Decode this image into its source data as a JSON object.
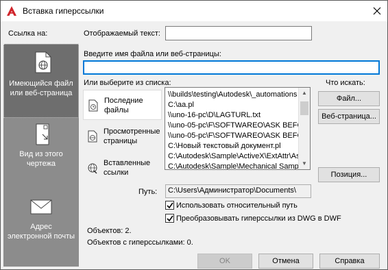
{
  "window": {
    "title": "Вставка гиперссылки"
  },
  "icons": {
    "app": "autocad-icon",
    "close": "close-icon"
  },
  "sidebar": {
    "header": "Ссылка на:",
    "items": [
      {
        "label_line1": "Имеющийся файл",
        "label_line2": "или веб-страница",
        "icon": "file-globe-icon",
        "selected": true
      },
      {
        "label_line1": "Вид из этого",
        "label_line2": "чертежа",
        "icon": "drawing-view-icon",
        "selected": false
      },
      {
        "label_line1": "Адрес",
        "label_line2": "электронной почты",
        "icon": "email-icon",
        "selected": false
      }
    ]
  },
  "form": {
    "display_text_label": "Отображаемый текст:",
    "display_text_value": "",
    "filename_label": "Введите имя файла или веб-страницы:",
    "filename_value": "",
    "select_list_label": "Или выберите из списка:",
    "search_label": "Что искать:"
  },
  "tabs": [
    {
      "line1": "Последние",
      "line2": "файлы",
      "icon": "recent-files-icon",
      "selected": true
    },
    {
      "line1": "Просмотренные",
      "line2": "страницы",
      "icon": "browsed-pages-icon",
      "selected": false
    },
    {
      "line1": "Вставленные",
      "line2": "ссылки",
      "icon": "inserted-links-icon",
      "selected": false
    }
  ],
  "list_items": [
    "\\\\builds\\testing\\Autodesk\\_automations",
    "C:\\aa.pl",
    "\\\\uno-16-pc\\D\\LAGTURL.txt",
    "\\\\uno-05-pc\\F\\SOFTWAREO\\ASK BEFOR",
    "\\\\uno-05-pc\\F\\SOFTWAREO\\ASK BEFOR",
    "C:\\Новый текстовый документ.pl",
    "C:\\Autodesk\\Sample\\ActiveX\\ExtAttr\\As",
    "C:\\Autodesk\\Sample\\Mechanical Sample"
  ],
  "buttons": {
    "file": "Файл...",
    "web_page": "Веб-страница...",
    "position": "Позиция...",
    "ok": "OK",
    "cancel": "Отмена",
    "help": "Справка"
  },
  "path": {
    "label": "Путь:",
    "value": "C:\\Users\\Администратор\\Documents\\"
  },
  "checkboxes": {
    "relative_path": {
      "label": "Использовать относительный путь",
      "checked": true
    },
    "convert_dwg": {
      "label": "Преобразовывать гиперссылки из DWG в DWF",
      "checked": true
    }
  },
  "status": {
    "objects": "Объектов: 2.",
    "objects_with_links": "Объектов с гиперссылками: 0."
  },
  "colors": {
    "accent": "#0078d7",
    "sidebar": "#8c8c8c",
    "sidebar_selected": "#6e6e6e",
    "autocad_red": "#d0252b"
  }
}
